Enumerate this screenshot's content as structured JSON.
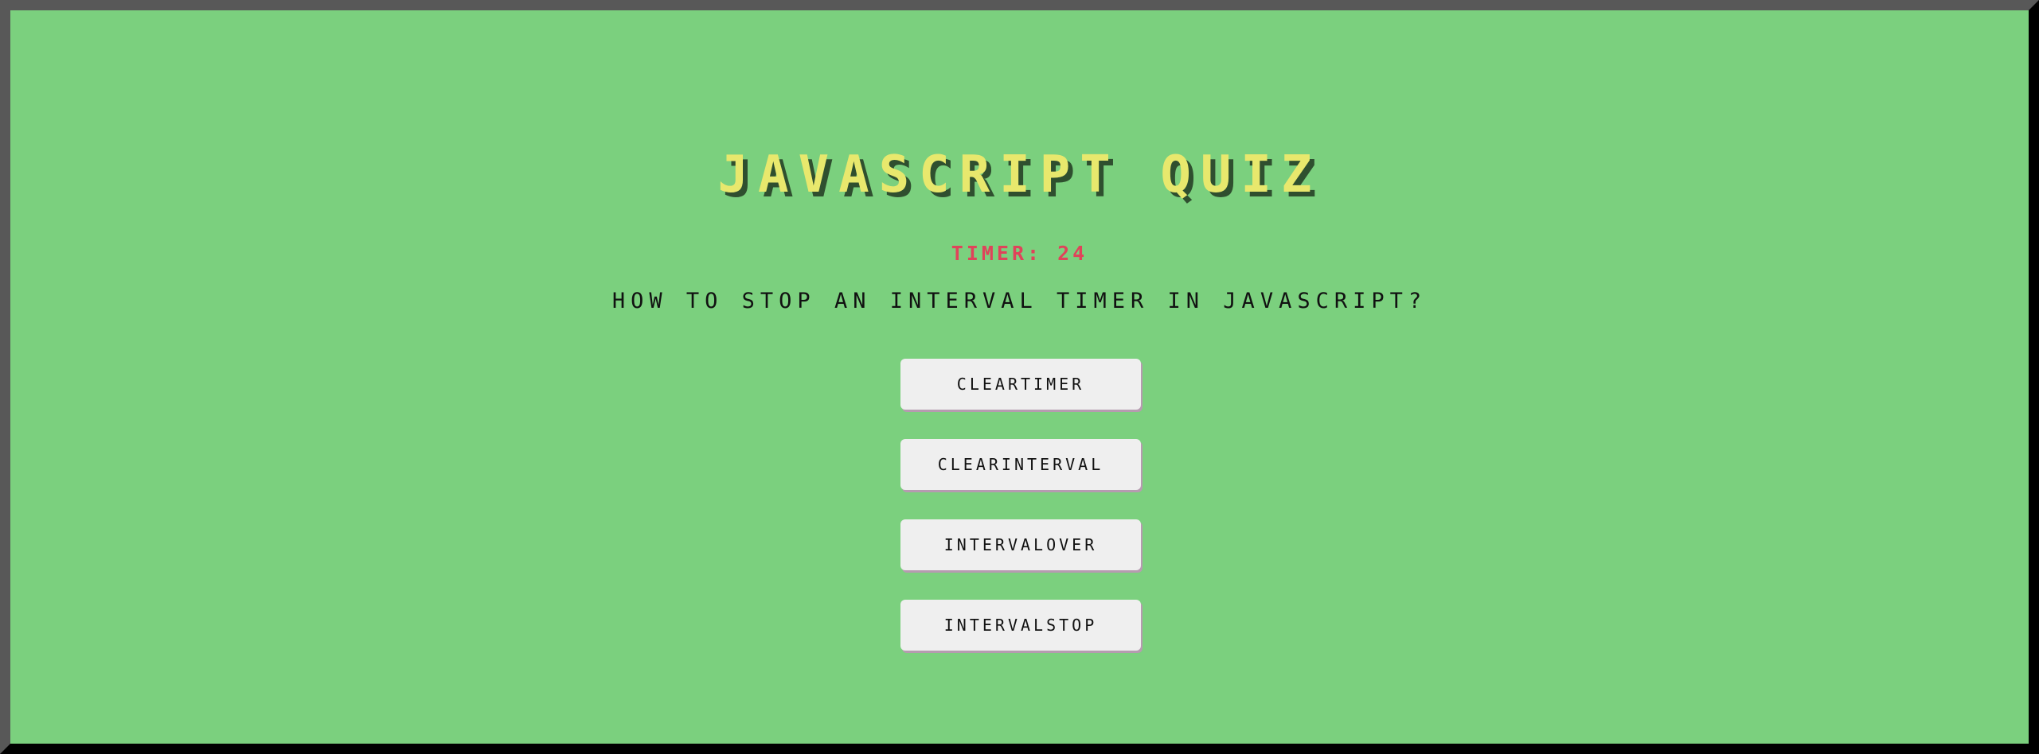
{
  "quiz": {
    "title": "JAVASCRIPT QUIZ",
    "timer_text": "TIMER: 24",
    "question": "HOW TO STOP AN INTERVAL TIMER IN JAVASCRIPT?",
    "choices": [
      {
        "label": "CLEARTIMER"
      },
      {
        "label": "CLEARINTERVAL"
      },
      {
        "label": "INTERVALOVER"
      },
      {
        "label": "INTERVALSTOP"
      }
    ]
  },
  "colors": {
    "background": "#7bd07e",
    "title": "#e8e86d",
    "timer": "#e0435a",
    "button_bg": "#efefef",
    "frame_light": "#585858",
    "frame_dark": "#000000"
  }
}
